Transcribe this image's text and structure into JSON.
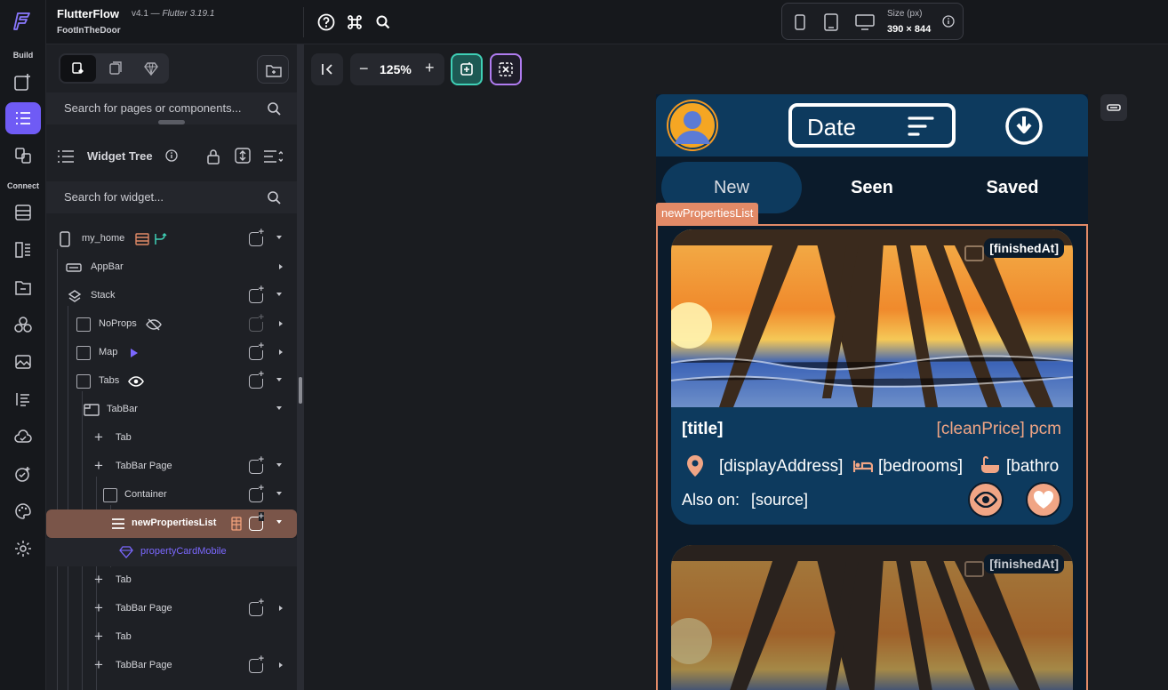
{
  "rail": {
    "build_label": "Build",
    "connect_label": "Connect",
    "icons": [
      "flutterflow-logo-icon",
      "add-page-icon",
      "widget-tree-icon",
      "page-selector-icon",
      "database-icon",
      "api-icon",
      "storage-icon",
      "theme-icon",
      "media-icon",
      "text-icon",
      "cloud-icon",
      "agent-icon",
      "settings-icon"
    ]
  },
  "topbar": {
    "app_name": "FlutterFlow",
    "version": "v4.1 — ",
    "flutter_version": "Flutter 3.19.1",
    "project_name": "FootInTheDoor",
    "size_label": "Size (px)",
    "size_value": "390 × 844"
  },
  "panel": {
    "page_search_placeholder": "Search for pages or components...",
    "widget_tree_title": "Widget Tree",
    "widget_search_placeholder": "Search for widget...",
    "tree": [
      {
        "label": "my_home"
      },
      {
        "label": "AppBar"
      },
      {
        "label": "Stack"
      },
      {
        "label": "NoProps"
      },
      {
        "label": "Map"
      },
      {
        "label": "Tabs"
      },
      {
        "label": "TabBar"
      },
      {
        "label": "Tab"
      },
      {
        "label": "TabBar Page"
      },
      {
        "label": "Container"
      },
      {
        "label": "newPropertiesList"
      },
      {
        "label": "propertyCardMobile"
      },
      {
        "label": "Tab"
      },
      {
        "label": "TabBar Page"
      },
      {
        "label": "Tab"
      },
      {
        "label": "TabBar Page"
      }
    ]
  },
  "canvas": {
    "zoom": "125%"
  },
  "phone": {
    "sort_label": "Date",
    "tabs": [
      "New",
      "Seen",
      "Saved"
    ],
    "selection_label": "newPropertiesList",
    "card": {
      "finished_at": "[finishedAt]",
      "title": "[title]",
      "price": "[cleanPrice] pcm",
      "address": "[displayAddress]",
      "bedrooms": "[bedrooms]",
      "bathrooms": "[bathro",
      "also_on": "Also on:",
      "source": "[source]"
    }
  },
  "colors": {
    "accent": "#6f5bf5",
    "app_primary": "#0d3a5e",
    "app_bg": "#0b1b2b",
    "highlight": "#e28a67",
    "price": "#f0a585"
  }
}
